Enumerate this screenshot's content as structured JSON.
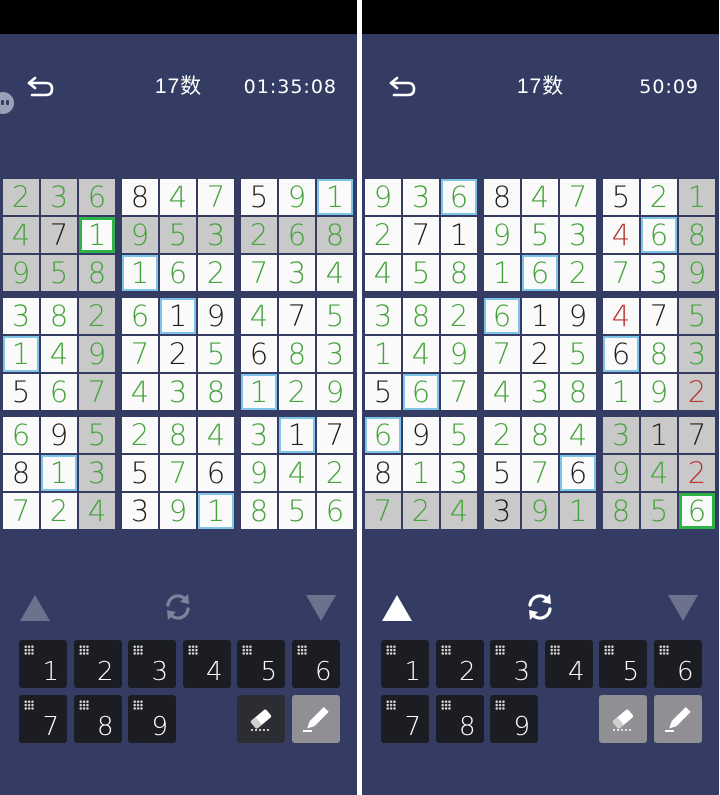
{
  "colors": {
    "background": "#343c63",
    "cell_white": "#fafafa",
    "cell_gray": "#c9c9c9",
    "given_digit": "#1e1e1e",
    "entered_digit": "#45a33b",
    "error_digit": "#b8342d",
    "highlight": "#7ec4e6",
    "selected": "#2fb24a"
  },
  "icons": {
    "back": "undo-arrow-icon",
    "refresh": "refresh-icon",
    "eraser": "eraser-icon",
    "pencil": "pencil-icon",
    "arrow_up": "triangle-up-icon",
    "arrow_down": "triangle-down-icon"
  },
  "screens": [
    {
      "title": "17数",
      "timer": "01:35:08",
      "show_side_icon": true,
      "up_arrow_active": false,
      "eraser_active": false,
      "pencil_active": true,
      "grid": [
        [
          "2g*",
          "3g*",
          "6g*",
          "8wf",
          "4w*",
          "7w*",
          "5wf",
          "9w*",
          "1w*b"
        ],
        [
          "4g*",
          "7gf",
          "1w*s",
          "9g*",
          "5g*",
          "3g*",
          "2g*",
          "6g*",
          "8g*"
        ],
        [
          "9g*",
          "5g*",
          "8g*",
          "1w*b",
          "6w*",
          "2w*",
          "7w*",
          "3w*",
          "4w*"
        ],
        [
          "3w*",
          "8w*",
          "2g*",
          "6w*",
          "1wfb",
          "9wf",
          "4w*",
          "7wf",
          "5w*"
        ],
        [
          "1w*b",
          "4w*",
          "9g*",
          "7w*",
          "2wf",
          "5w*",
          "6wf",
          "8w*",
          "3w*"
        ],
        [
          "5wf",
          "6w*",
          "7g*",
          "4w*",
          "3w*",
          "8w*",
          "1w*b",
          "2w*",
          "9w*"
        ],
        [
          "6w*",
          "9wf",
          "5g*",
          "2w*",
          "8w*",
          "4w*",
          "3w*",
          "1wfb",
          "7wf"
        ],
        [
          "8wf",
          "1w*b",
          "3g*",
          "5wf",
          "7w*",
          "6wf",
          "9w*",
          "4w*",
          "2w*"
        ],
        [
          "7w*",
          "2w*",
          "4g*",
          "3wf",
          "9w*",
          "1w*b",
          "8w*",
          "5w*",
          "6w*"
        ]
      ]
    },
    {
      "title": "17数",
      "timer": "50:09",
      "show_side_icon": false,
      "up_arrow_active": true,
      "eraser_active": true,
      "pencil_active": true,
      "grid": [
        [
          "9w*",
          "3w*",
          "6w*b",
          "8wf",
          "4w*",
          "7w*",
          "5wf",
          "2w*",
          "1g*"
        ],
        [
          "2w*",
          "7wf",
          "1wf",
          "9w*",
          "5w*",
          "3w*",
          "4wr",
          "6w*b",
          "8g*"
        ],
        [
          "4w*",
          "5w*",
          "8w*",
          "1w*",
          "6w*b",
          "2w*",
          "7w*",
          "3w*",
          "9g*"
        ],
        [
          "3w*",
          "8w*",
          "2w*",
          "6w*b",
          "1wf",
          "9wf",
          "4wr",
          "7wf",
          "5g*"
        ],
        [
          "1w*",
          "4w*",
          "9w*",
          "7w*",
          "2wf",
          "5w*",
          "6wfb",
          "8w*",
          "3g*"
        ],
        [
          "5wf",
          "6w*b",
          "7w*",
          "4w*",
          "3w*",
          "8w*",
          "1w*",
          "9w*",
          "2gr"
        ],
        [
          "6w*b",
          "9wf",
          "5w*",
          "2w*",
          "8w*",
          "4w*",
          "3g*",
          "1gf",
          "7gf"
        ],
        [
          "8wf",
          "1w*",
          "3w*",
          "5wf",
          "7w*",
          "6wfb",
          "9g*",
          "4g*",
          "2gr"
        ],
        [
          "7g*",
          "2g*",
          "4g*",
          "3gf",
          "9g*",
          "1g*",
          "8g*",
          "5g*",
          "6w*s"
        ]
      ]
    }
  ],
  "keypad": [
    "1",
    "2",
    "3",
    "4",
    "5",
    "6",
    "7",
    "8",
    "9"
  ]
}
